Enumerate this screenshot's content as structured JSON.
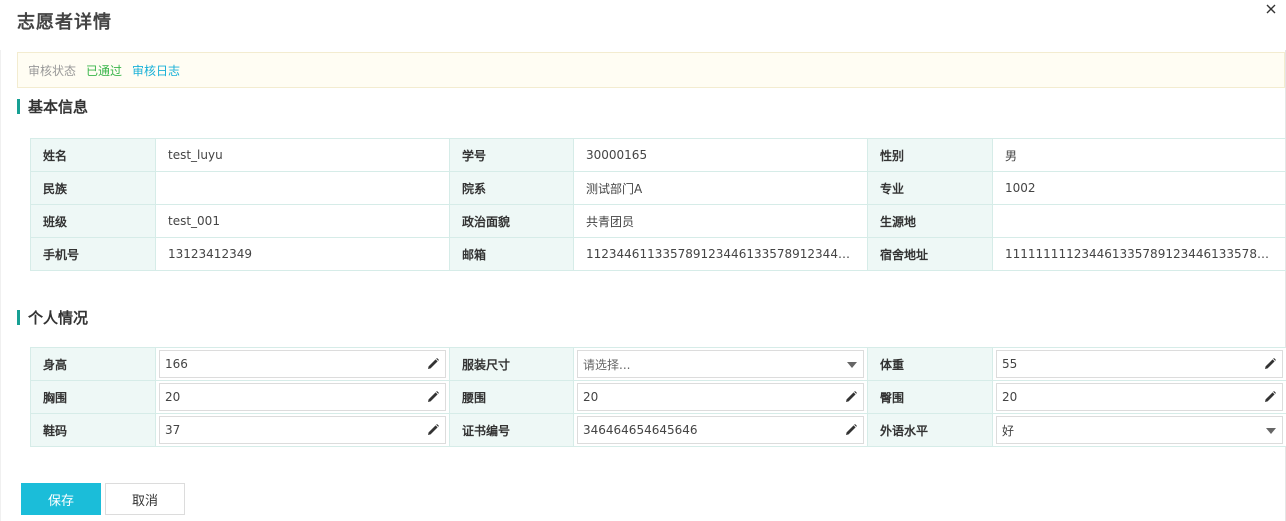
{
  "dialog": {
    "title": "志愿者详情"
  },
  "audit": {
    "label": "审核状态",
    "status": "已通过",
    "log_link": "审核日志"
  },
  "basic": {
    "title": "基本信息",
    "rows": [
      [
        {
          "label": "姓名",
          "value": "test_luyu"
        },
        {
          "label": "学号",
          "value": "30000165"
        },
        {
          "label": "性别",
          "value": "男"
        }
      ],
      [
        {
          "label": "民族",
          "value": ""
        },
        {
          "label": "院系",
          "value": "测试部门A"
        },
        {
          "label": "专业",
          "value": "1002"
        }
      ],
      [
        {
          "label": "班级",
          "value": "test_001"
        },
        {
          "label": "政治面貌",
          "value": "共青团员"
        },
        {
          "label": "生源地",
          "value": ""
        }
      ],
      [
        {
          "label": "手机号",
          "value": "13123412349"
        },
        {
          "label": "邮箱",
          "value": "11234461133578912344613357891234461335789123446133..."
        },
        {
          "label": "宿舍地址",
          "value": "11111111123446133578912344613357891234461335789123..."
        }
      ]
    ]
  },
  "personal": {
    "title": "个人情况",
    "rows": [
      [
        {
          "label": "身高",
          "value": "166",
          "kind": "text"
        },
        {
          "label": "服装尺寸",
          "value": "请选择...",
          "kind": "select"
        },
        {
          "label": "体重",
          "value": "55",
          "kind": "text"
        }
      ],
      [
        {
          "label": "胸围",
          "value": "20",
          "kind": "text"
        },
        {
          "label": "腰围",
          "value": "20",
          "kind": "text"
        },
        {
          "label": "臀围",
          "value": "20",
          "kind": "text"
        }
      ],
      [
        {
          "label": "鞋码",
          "value": "37",
          "kind": "text"
        },
        {
          "label": "证书编号",
          "value": "346464654645646",
          "kind": "text"
        },
        {
          "label": "外语水平",
          "value": "好",
          "kind": "select"
        }
      ]
    ]
  },
  "actions": {
    "save_label": "保存",
    "cancel_label": "取消"
  },
  "icons": {
    "close": "close-icon",
    "edit": "pencil-icon",
    "dropdown": "chevron-down-icon"
  },
  "colors": {
    "accent": "#17a094",
    "primary_button": "#1bbdd9",
    "status_ok": "#39b54a",
    "link": "#1ab1d8"
  }
}
